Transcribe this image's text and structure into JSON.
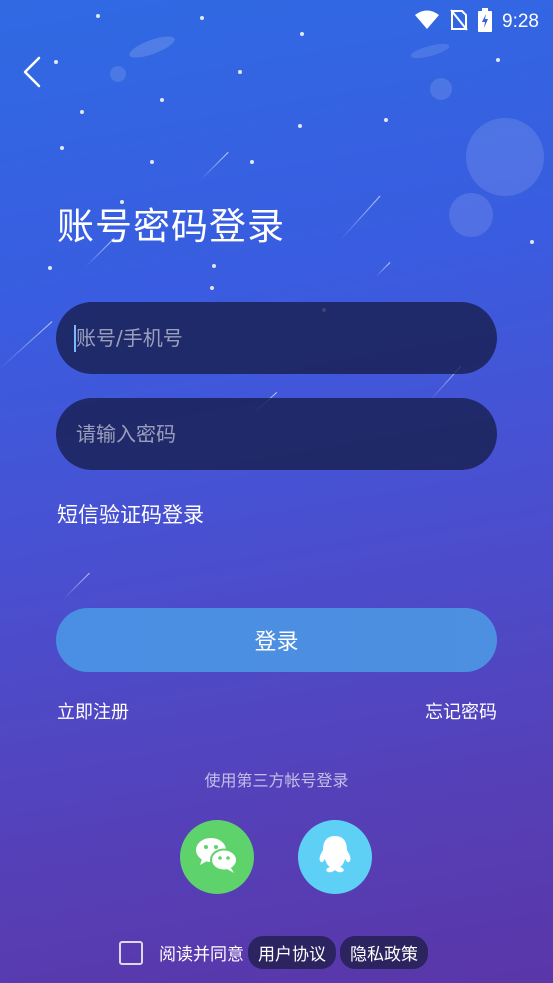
{
  "status_bar": {
    "time": "9:28"
  },
  "title": "账号密码登录",
  "account_input": {
    "placeholder": "账号/手机号",
    "value": ""
  },
  "password_input": {
    "placeholder": "请输入密码",
    "value": ""
  },
  "sms_login_label": "短信验证码登录",
  "login_button_label": "登录",
  "register_label": "立即注册",
  "forgot_password_label": "忘记密码",
  "third_party_label": "使用第三方帐号登录",
  "social": [
    {
      "name": "wechat",
      "color": "#5ed36b",
      "icon": "wechat-icon"
    },
    {
      "name": "qq",
      "color": "#5ed0f6",
      "icon": "qq-icon"
    }
  ],
  "agreement": {
    "checked": false,
    "prefix": "阅读并同意",
    "user_agreement": "用户协议",
    "privacy_policy": "隐私政策"
  },
  "colors": {
    "background_top": "#2f6ae3",
    "background_bottom": "#5a36a8",
    "login_button": "#4a8fe4",
    "input_background": "#192050"
  }
}
